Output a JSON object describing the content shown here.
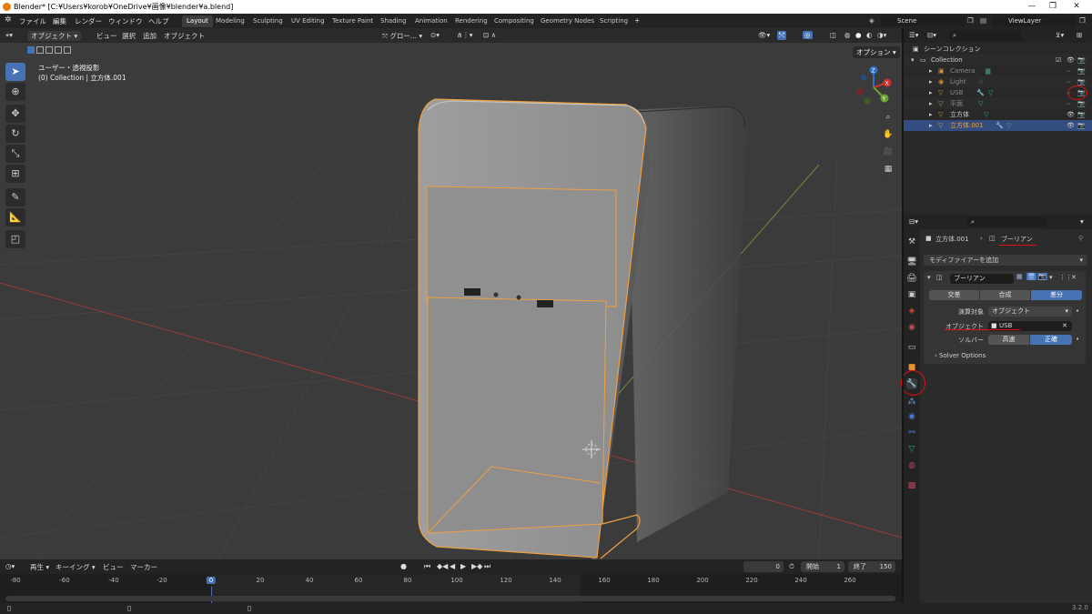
{
  "window": {
    "title": "Blender* [C:¥Users¥korob¥OneDrive¥画像¥blender¥a.blend]"
  },
  "menu": [
    "ファイル",
    "編集",
    "レンダー",
    "ウィンドウ",
    "ヘルプ"
  ],
  "workspaces": [
    "Layout",
    "Modeling",
    "Sculpting",
    "UV Editing",
    "Texture Paint",
    "Shading",
    "Animation",
    "Rendering",
    "Compositing",
    "Geometry Nodes",
    "Scripting"
  ],
  "scene": {
    "name": "Scene",
    "view_layer": "ViewLayer"
  },
  "viewport": {
    "mode": "オブジェクト",
    "header_menus": [
      "ビュー",
      "選択",
      "追加",
      "オブジェクト"
    ],
    "transform_orientation": "グロー...",
    "options": "オプション",
    "view_name": "ユーザー・透視投影",
    "view_sub": "(0) Collection | 立方体.001",
    "gizmo_axes": [
      "X",
      "Y",
      "Z"
    ]
  },
  "timeline": {
    "menus": [
      "再生",
      "キーイング",
      "ビュー",
      "マーカー"
    ],
    "current_frame": "0",
    "start_label": "開始",
    "start": "1",
    "end_label": "終了",
    "end": "150",
    "ticks": [
      "-80",
      "-60",
      "-40",
      "-20",
      "0",
      "20",
      "40",
      "60",
      "80",
      "100",
      "120",
      "140",
      "160",
      "180",
      "200",
      "220",
      "240",
      "260"
    ]
  },
  "outliner": {
    "root": "シーンコレクション",
    "collection": "Collection",
    "items": [
      {
        "name": "Camera",
        "color": "#8a8a8a"
      },
      {
        "name": "Light",
        "color": "#8a8a8a"
      },
      {
        "name": "USB",
        "color": "#8a8a8a"
      },
      {
        "name": "平面",
        "color": "#8a8a8a"
      },
      {
        "name": "立方体",
        "color": "#d0d0d0"
      },
      {
        "name": "立方体.001",
        "color": "#f0a040"
      }
    ]
  },
  "properties": {
    "breadcrumb_object": "立方体.001",
    "breadcrumb_modifier": "ブーリアン",
    "add_modifier": "モディファイアーを追加",
    "modifier_name": "ブーリアン",
    "operations": [
      "交差",
      "合成",
      "差分"
    ],
    "operation_active": "差分",
    "operand_label": "演算対象",
    "operand_value": "オブジェクト",
    "object_label": "オブジェクト",
    "object_value": "USB",
    "solver_label": "ソルバー",
    "solvers": [
      "高速",
      "正確"
    ],
    "solver_active": "正確",
    "solver_options": "Solver Options"
  },
  "status": {
    "version": "3.2.0"
  },
  "colors": {
    "accent": "#4772b3",
    "selection": "#f0a040",
    "annotation": "#e01010"
  }
}
